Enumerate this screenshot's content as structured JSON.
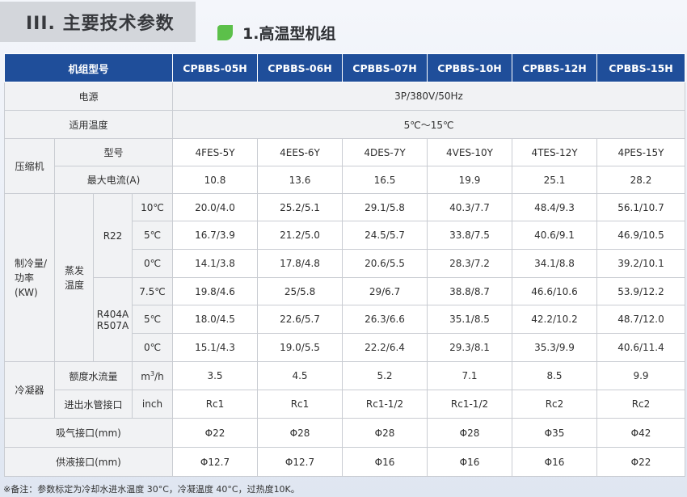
{
  "section_title": "III. 主要技术参数",
  "sub_title": "1.高温型机组",
  "table": {
    "header_label": "机组型号",
    "models": [
      "CPBBS-05H",
      "CPBBS-06H",
      "CPBBS-07H",
      "CPBBS-10H",
      "CPBBS-12H",
      "CPBBS-15H"
    ],
    "power_label": "电源",
    "power_value": "3P/380V/50Hz",
    "temp_label": "适用温度",
    "temp_value": "5℃～15℃",
    "compressor_label": "压缩机",
    "compressor_rows": [
      {
        "label": "型号",
        "values": [
          "4FES-5Y",
          "4EES-6Y",
          "4DES-7Y",
          "4VES-10Y",
          "4TES-12Y",
          "4PES-15Y"
        ]
      },
      {
        "label": "最大电流(A)",
        "values": [
          "10.8",
          "13.6",
          "16.5",
          "19.9",
          "25.1",
          "28.2"
        ]
      }
    ],
    "cooling_label_1": "制冷量/",
    "cooling_label_2": "功率(KW)",
    "evap_label_1": "蒸发",
    "evap_label_2": "温度",
    "r22_label": "R22",
    "r404_label_1": "R404A",
    "r404_label_2": "R507A",
    "cooling_rows": [
      {
        "temp": "10℃",
        "values": [
          "20.0/4.0",
          "25.2/5.1",
          "29.1/5.8",
          "40.3/7.7",
          "48.4/9.3",
          "56.1/10.7"
        ]
      },
      {
        "temp": "5℃",
        "values": [
          "16.7/3.9",
          "21.2/5.0",
          "24.5/5.7",
          "33.8/7.5",
          "40.6/9.1",
          "46.9/10.5"
        ]
      },
      {
        "temp": "0℃",
        "values": [
          "14.1/3.8",
          "17.8/4.8",
          "20.6/5.5",
          "28.3/7.2",
          "34.1/8.8",
          "39.2/10.1"
        ]
      },
      {
        "temp": "7.5℃",
        "values": [
          "19.8/4.6",
          "25/5.8",
          "29/6.7",
          "38.8/8.7",
          "46.6/10.6",
          "53.9/12.2"
        ]
      },
      {
        "temp": "5℃",
        "values": [
          "18.0/4.5",
          "22.6/5.7",
          "26.3/6.6",
          "35.1/8.5",
          "42.2/10.2",
          "48.7/12.0"
        ]
      },
      {
        "temp": "0℃",
        "values": [
          "15.1/4.3",
          "19.0/5.5",
          "22.2/6.4",
          "29.3/8.1",
          "35.3/9.9",
          "40.6/11.4"
        ]
      }
    ],
    "condenser_label": "冷凝器",
    "water_flow_label": "额度水流量",
    "water_flow_unit_base": "m",
    "water_flow_unit_sup": "3",
    "water_flow_unit_tail": "/h",
    "water_flow_values": [
      "3.5",
      "4.5",
      "5.2",
      "7.1",
      "8.5",
      "9.9"
    ],
    "pipe_label": "进出水管接口",
    "pipe_unit": "inch",
    "pipe_values": [
      "Rc1",
      "Rc1",
      "Rc1-1/2",
      "Rc1-1/2",
      "Rc2",
      "Rc2"
    ],
    "suction_label": "吸气接口(mm)",
    "suction_values": [
      "Φ22",
      "Φ28",
      "Φ28",
      "Φ28",
      "Φ35",
      "Φ42"
    ],
    "liquid_label": "供液接口(mm)",
    "liquid_values": [
      "Φ12.7",
      "Φ12.7",
      "Φ16",
      "Φ16",
      "Φ16",
      "Φ22"
    ]
  },
  "note": "※备注：参数标定为冷却水进水温度 30°C，冷凝温度 40°C，过热度10K。",
  "colors": {
    "header_blue": "#1f4e9a",
    "accent_green": "#5cc04a",
    "section_box_gray": "#d3d6db"
  }
}
